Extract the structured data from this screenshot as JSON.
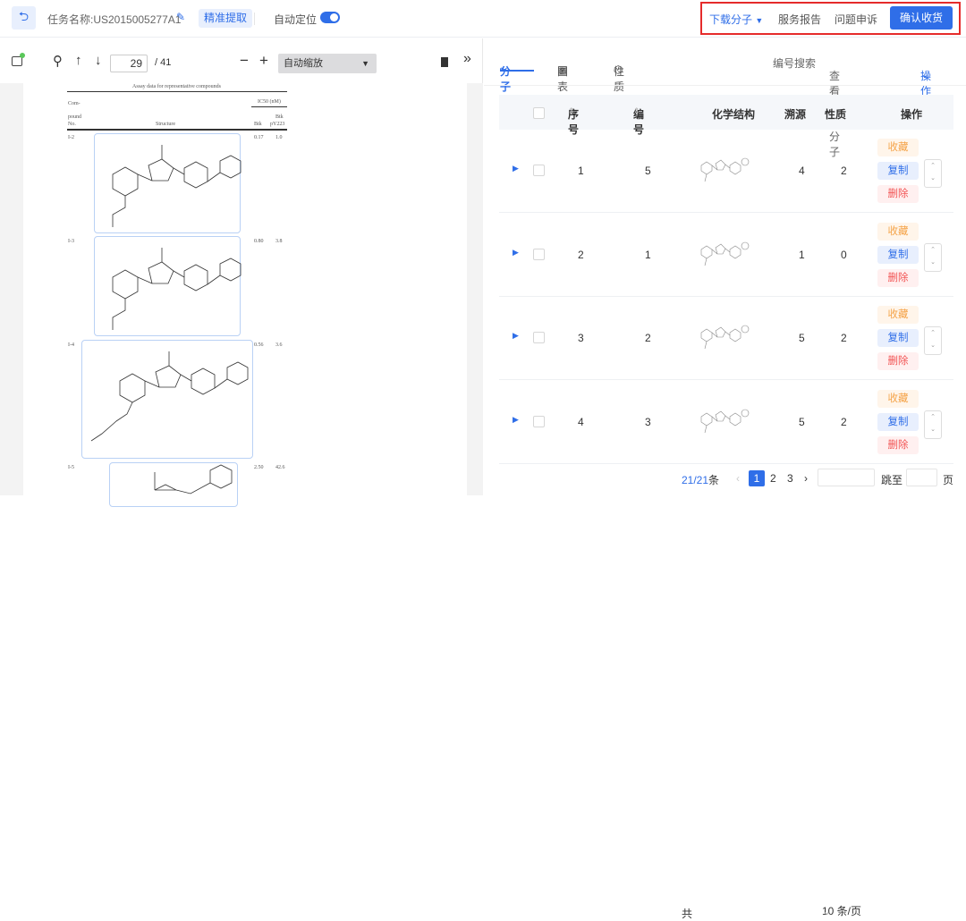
{
  "header": {
    "task_label": "任务名称:US2015005277A1",
    "precise_extract": "精准提取",
    "auto_locate": "自动定位",
    "auto_locate_on": true,
    "download": "下载分子",
    "service_report": "服务报告",
    "issue_report": "问题申诉",
    "confirm": "确认收货"
  },
  "viewer": {
    "page": "29",
    "total": "/ 41",
    "zoom": "自动缩放"
  },
  "document": {
    "title": "Assay data for representative compounds",
    "col_compound_1": "Com-",
    "col_compound_2": "pound",
    "col_compound_3": "No.",
    "col_ic50": "IC50 (nM)",
    "col_structure": "Structure",
    "col_btk": "Btk",
    "col_btk_p_1": "Btk",
    "col_btk_p_2": "pY223",
    "rows": [
      {
        "id": "I-2",
        "btk": "0.17",
        "py": "1.0"
      },
      {
        "id": "I-3",
        "btk": "0.80",
        "py": "3.8"
      },
      {
        "id": "I-4",
        "btk": "0.56",
        "py": "3.6"
      },
      {
        "id": "I-5",
        "btk": "2.50",
        "py": "42.6"
      }
    ]
  },
  "tabs": [
    {
      "label": "分子"
    },
    {
      "label": "图表"
    },
    {
      "label": "性质"
    }
  ],
  "filters": {
    "search": "编号搜索",
    "view_all": "查看全部分子",
    "actions": "操作"
  },
  "table": {
    "headers": [
      "序号",
      "编号",
      "化学结构",
      "溯源",
      "性质",
      "操作"
    ],
    "rows": [
      {
        "seq": "1",
        "id": "5",
        "source": "4",
        "prop": "2"
      },
      {
        "seq": "2",
        "id": "1",
        "source": "1",
        "prop": "0"
      },
      {
        "seq": "3",
        "id": "2",
        "source": "5",
        "prop": "2"
      },
      {
        "seq": "4",
        "id": "3",
        "source": "5",
        "prop": "2"
      }
    ],
    "actions": {
      "fav": "收藏",
      "copy": "复制",
      "delete": "删除"
    }
  },
  "pagination": {
    "total_prefix": "共",
    "total": "21/21",
    "total_suffix": "条",
    "pages": [
      "1",
      "2",
      "3"
    ],
    "current": "1",
    "page_size": "10 条/页",
    "jump": "跳至",
    "page_unit": "页"
  },
  "colors": {
    "accent": "#2f6ee8",
    "highlight": "#e52b2b"
  }
}
